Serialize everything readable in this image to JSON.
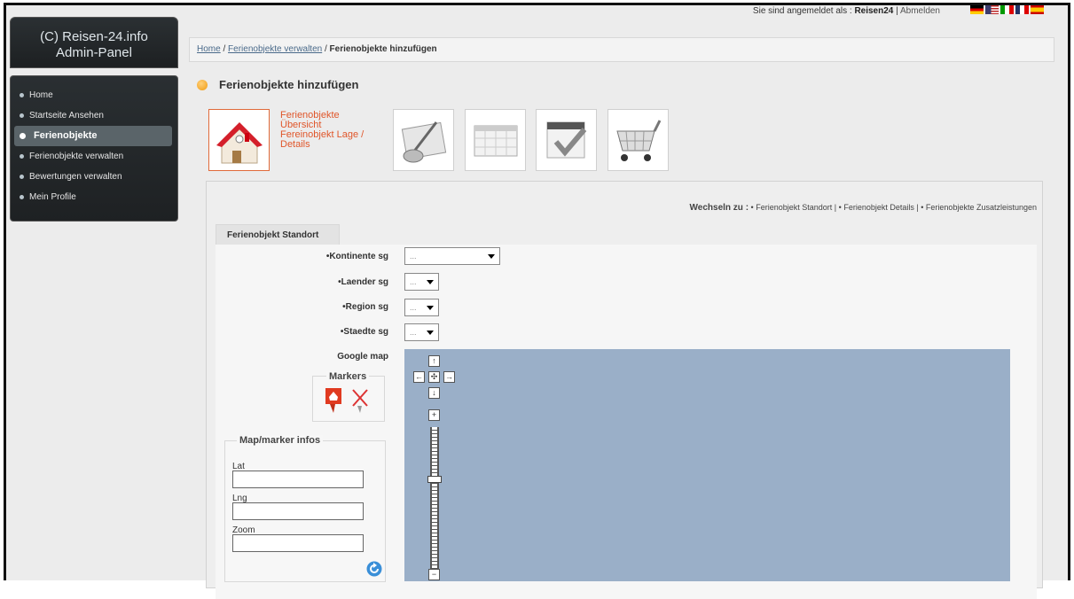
{
  "sidebar": {
    "header_line1": "(C) Reisen-24.info",
    "header_line2": "Admin-Panel",
    "items": [
      {
        "label": "Home"
      },
      {
        "label": "Startseite Ansehen"
      },
      {
        "label": "Ferienobjekte"
      },
      {
        "label": "Ferienobjekte verwalten"
      },
      {
        "label": "Bewertungen verwalten"
      },
      {
        "label": "Mein Profile"
      }
    ]
  },
  "topbar": {
    "login_prefix": "Sie sind angemeldet als : ",
    "user": "Reisen24",
    "separator": " | ",
    "logout": "Abmelden",
    "flags": [
      "german-flag-icon",
      "us-flag-icon",
      "italian-flag-icon",
      "french-flag-icon",
      "spanish-flag-icon"
    ]
  },
  "breadcrumb": {
    "home": "Home",
    "sep": " / ",
    "manage": "Ferienobjekte verwalten",
    "current": "Ferienobjekte hinzufügen"
  },
  "page_title": "Ferienobjekte hinzufügen",
  "steps": {
    "label_line1": "Ferienobjekte",
    "label_line2": "Übersicht",
    "label_line3": "Fereinobjekt Lage /",
    "label_line4": "Details",
    "icons": [
      "house-icon",
      "brush-icon",
      "calendar-icon",
      "checked-calendar-icon",
      "shopping-cart-icon"
    ]
  },
  "switch": {
    "label": "Wechseln zu :",
    "link1": "Ferienobjekt Standort",
    "link2": "Ferienobjekt Details",
    "link3": "Ferienobjekte Zusatzleistungen",
    "bullet": "•",
    "pipe": "|"
  },
  "tab": "Ferienobjekt Standort",
  "form": {
    "kontinente_label": "•Kontinente sg",
    "laender_label": "•Laender sg",
    "region_label": "•Region sg",
    "staedte_label": "•Staedte sg",
    "select_value": "...",
    "map_label": "Google map"
  },
  "markers": {
    "title": "Markers",
    "icons": [
      "house-marker-icon",
      "delete-marker-icon"
    ]
  },
  "mapinfo": {
    "title": "Map/marker infos",
    "lat_label": "Lat",
    "lng_label": "Lng",
    "zoom_label": "Zoom",
    "lat_value": "",
    "lng_value": "",
    "zoom_value": ""
  },
  "map_controls": {
    "up": "↑",
    "left": "←",
    "center": "✣",
    "right": "→",
    "down": "↓",
    "zoom_in": "+",
    "zoom_out": "−"
  },
  "colors": {
    "accent": "#e0562a",
    "map": "#9aafc8",
    "sidebar": "#23282a"
  }
}
